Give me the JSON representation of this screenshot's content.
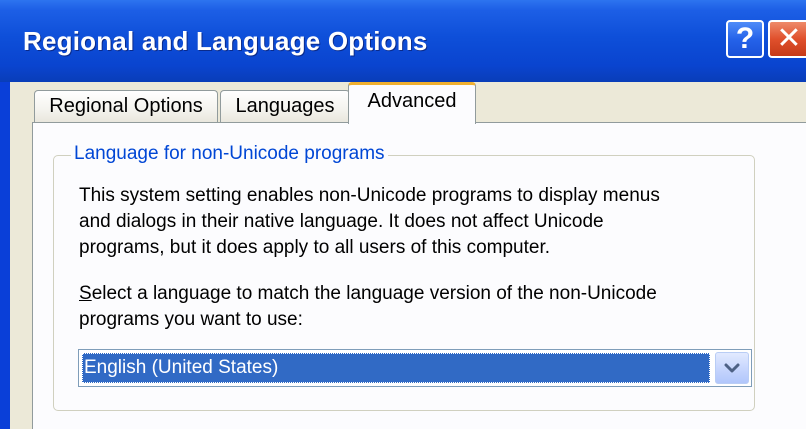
{
  "window": {
    "title": "Regional and Language Options",
    "help_label": "?",
    "close_label": "✕"
  },
  "tabs": [
    {
      "label": "Regional Options",
      "active": false
    },
    {
      "label": "Languages",
      "active": false
    },
    {
      "label": "Advanced",
      "active": true
    }
  ],
  "group": {
    "title": "Language for non-Unicode programs",
    "description_lines": [
      "This system setting enables non-Unicode programs to display menus",
      "and dialogs in their native language. It does not affect Unicode",
      "programs, but it does apply to all users of this computer."
    ],
    "select_label_accel": "S",
    "select_label_line1_rest": "elect a language to match the language version of the non-Unicode",
    "select_label_line2": "programs you want to use:",
    "selected_language": "English (United States)"
  },
  "icons": {
    "help": "help-icon",
    "close": "close-icon",
    "dropdown": "chevron-down-icon"
  },
  "colors": {
    "titlebar": "#0a44cf",
    "close_button": "#e0502c",
    "active_tab_accent": "#f0b030",
    "group_title": "#0046d5",
    "selection": "#316ac5",
    "dialog_face": "#ece9d8"
  }
}
